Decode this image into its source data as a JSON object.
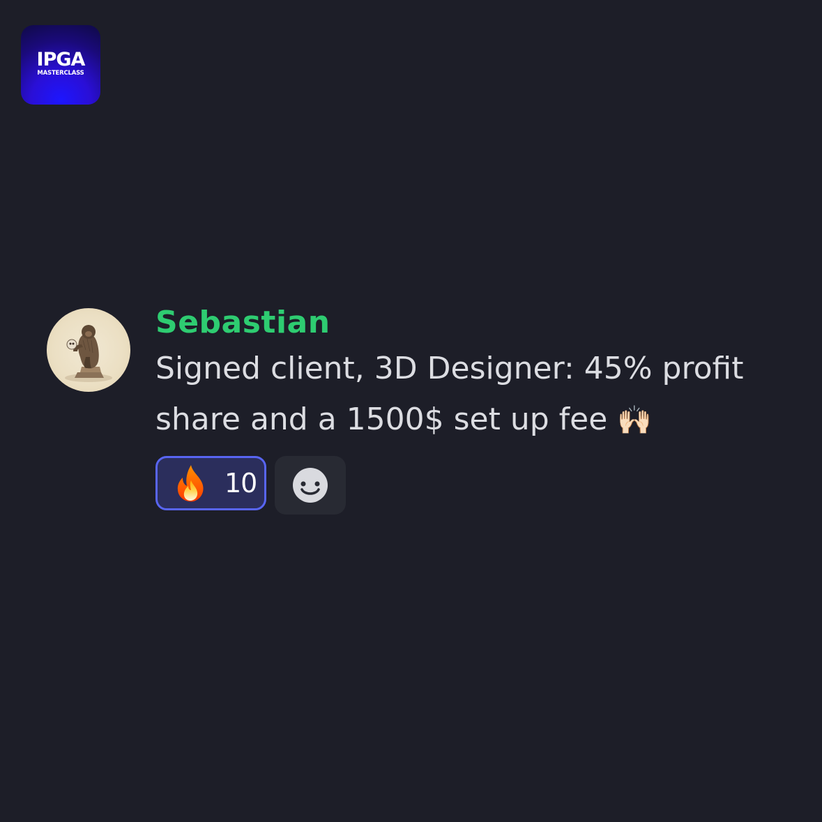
{
  "logo": {
    "main": "IPGA",
    "sub": "MASTERCLASS"
  },
  "message": {
    "username": "Sebastian",
    "text": "Signed client, 3D Designer: 45% profit share and a 1500$ set up fee",
    "emoji": "🙌🏻",
    "username_color": "#2ecc71"
  },
  "reactions": [
    {
      "emoji_icon": "fire-icon",
      "count": "10",
      "selected": true
    }
  ],
  "add_reaction": {
    "icon": "smiley-face-icon"
  }
}
